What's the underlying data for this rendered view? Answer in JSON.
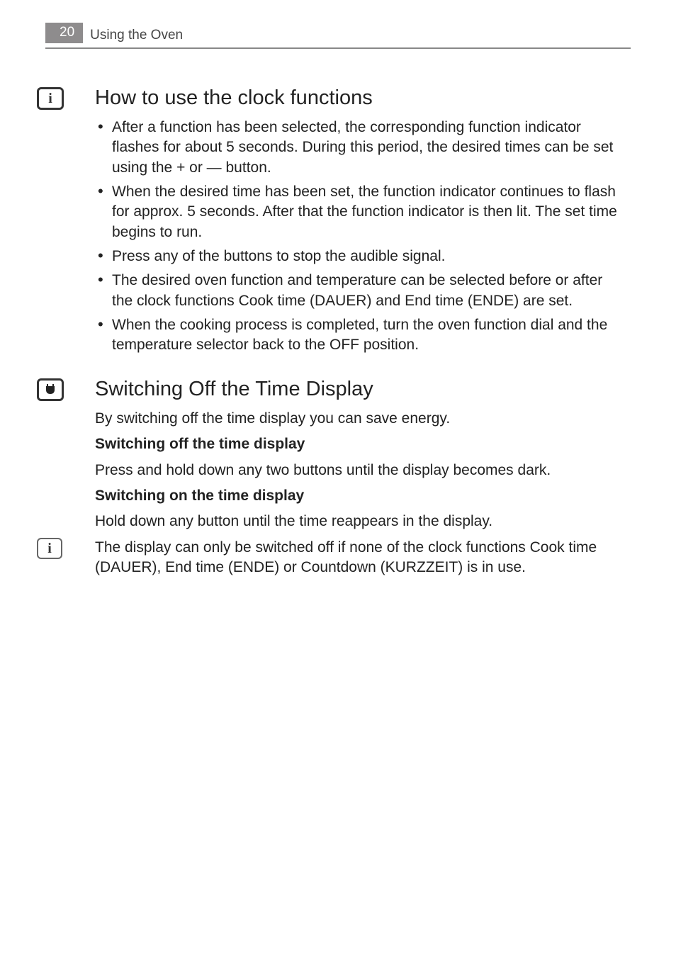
{
  "header": {
    "page_number": "20",
    "title": "Using the Oven"
  },
  "section1": {
    "icon": "info-icon",
    "heading": "How to use the clock functions",
    "bullets": [
      "After a function has been selected, the corresponding function indicator flashes for about 5 seconds. During this period, the desired times can be set using the + or — button.",
      "When the desired time has been set, the function indicator continues to flash for approx. 5 seconds. After that the function indicator is then lit. The set time begins to run.",
      "Press any of the buttons to stop the audible signal.",
      "The desired oven function and temperature can be selected before or after the clock functions Cook time (DAUER) and End time (ENDE) are set.",
      "When the cooking process is completed, turn the oven function dial and the temperature selector back to the OFF position."
    ]
  },
  "section2": {
    "icon": "plug-icon",
    "heading": "Switching Off the Time Display",
    "intro": "By switching off the time display you can save energy.",
    "sub1_title": "Switching off the time display",
    "sub1_body": "Press and hold down any two buttons until the display becomes dark.",
    "sub2_title": "Switching on the time display",
    "sub2_body": "Hold down any button until the time reappears in the display."
  },
  "note": {
    "icon": "info-icon",
    "text": "The display can only be switched off if none of the clock functions Cook time (DAUER), End time (ENDE) or Countdown (KURZZEIT) is in use."
  }
}
